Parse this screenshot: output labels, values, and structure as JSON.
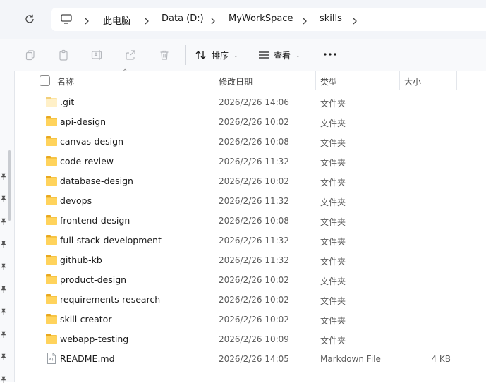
{
  "address": {
    "crumbs": [
      "此电脑",
      "Data (D:)",
      "MyWorkSpace",
      "skills"
    ]
  },
  "toolbar": {
    "sort_label": "排序",
    "view_label": "查看"
  },
  "columns": {
    "name": "名称",
    "modified": "修改日期",
    "type": "类型",
    "size": "大小"
  },
  "files": [
    {
      "name": ".git",
      "modified": "2026/2/26 14:06",
      "type": "文件夹",
      "size": "",
      "icon": "folder-hidden-icon"
    },
    {
      "name": "api-design",
      "modified": "2026/2/26 10:02",
      "type": "文件夹",
      "size": "",
      "icon": "folder-icon"
    },
    {
      "name": "canvas-design",
      "modified": "2026/2/26 10:08",
      "type": "文件夹",
      "size": "",
      "icon": "folder-icon"
    },
    {
      "name": "code-review",
      "modified": "2026/2/26 11:32",
      "type": "文件夹",
      "size": "",
      "icon": "folder-icon"
    },
    {
      "name": "database-design",
      "modified": "2026/2/26 10:02",
      "type": "文件夹",
      "size": "",
      "icon": "folder-icon"
    },
    {
      "name": "devops",
      "modified": "2026/2/26 11:32",
      "type": "文件夹",
      "size": "",
      "icon": "folder-icon"
    },
    {
      "name": "frontend-design",
      "modified": "2026/2/26 10:08",
      "type": "文件夹",
      "size": "",
      "icon": "folder-icon"
    },
    {
      "name": "full-stack-development",
      "modified": "2026/2/26 11:32",
      "type": "文件夹",
      "size": "",
      "icon": "folder-icon"
    },
    {
      "name": "github-kb",
      "modified": "2026/2/26 11:32",
      "type": "文件夹",
      "size": "",
      "icon": "folder-icon"
    },
    {
      "name": "product-design",
      "modified": "2026/2/26 10:02",
      "type": "文件夹",
      "size": "",
      "icon": "folder-icon"
    },
    {
      "name": "requirements-research",
      "modified": "2026/2/26 10:02",
      "type": "文件夹",
      "size": "",
      "icon": "folder-icon"
    },
    {
      "name": "skill-creator",
      "modified": "2026/2/26 10:02",
      "type": "文件夹",
      "size": "",
      "icon": "folder-icon"
    },
    {
      "name": "webapp-testing",
      "modified": "2026/2/26 10:09",
      "type": "文件夹",
      "size": "",
      "icon": "folder-icon"
    },
    {
      "name": "README.md",
      "modified": "2026/2/26 14:05",
      "type": "Markdown File",
      "size": "4 KB",
      "icon": "markdown-file-icon"
    }
  ],
  "colors": {
    "folder": "#ffd35c",
    "toolbar_bg": "#f8f9fb",
    "address_bg": "#f3f5f9"
  }
}
